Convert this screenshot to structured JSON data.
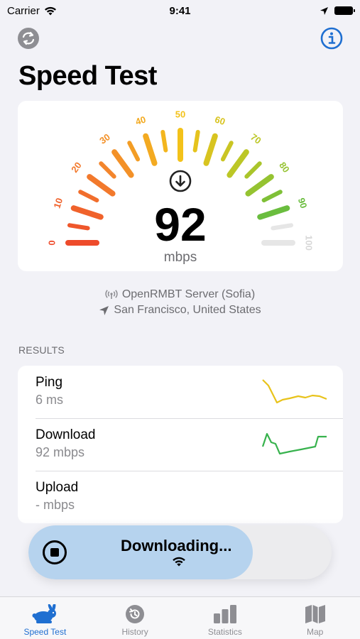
{
  "status_bar": {
    "carrier": "Carrier",
    "time": "9:41"
  },
  "nav": {
    "left_icon": "repeat-icon",
    "right_icon": "info-icon"
  },
  "title": "Speed Test",
  "gauge": {
    "value": "92",
    "unit": "mbps",
    "direction_icon": "download-arrow-icon",
    "max_value": 100,
    "current_value": 92,
    "tick_labels": [
      "0",
      "10",
      "20",
      "30",
      "40",
      "50",
      "60",
      "70",
      "80",
      "90",
      "100"
    ],
    "colors": {
      "low": "#ee4b2b",
      "mid_low": "#f3852c",
      "mid": "#f3c21a",
      "mid_high": "#b7c727",
      "high": "#3fb84a",
      "inactive": "#e6e6e6"
    }
  },
  "server": {
    "name": "OpenRMBT Server (Sofia)",
    "location": "San Francisco, United States"
  },
  "results": {
    "header": "RESULTS",
    "rows": [
      {
        "name": "Ping",
        "value": "6 ms",
        "spark_color": "#e8c31b"
      },
      {
        "name": "Download",
        "value": "92 mbps",
        "spark_color": "#37b24d"
      },
      {
        "name": "Upload",
        "value": "- mbps",
        "spark_color": ""
      }
    ]
  },
  "progress": {
    "label": "Downloading...",
    "fraction": 0.74,
    "fill_color": "#b6d3ee"
  },
  "tabs": [
    {
      "label": "Speed Test",
      "icon": "rabbit-icon",
      "active": true
    },
    {
      "label": "History",
      "icon": "history-icon",
      "active": false
    },
    {
      "label": "Statistics",
      "icon": "bar-chart-icon",
      "active": false
    },
    {
      "label": "Map",
      "icon": "map-icon",
      "active": false
    }
  ]
}
